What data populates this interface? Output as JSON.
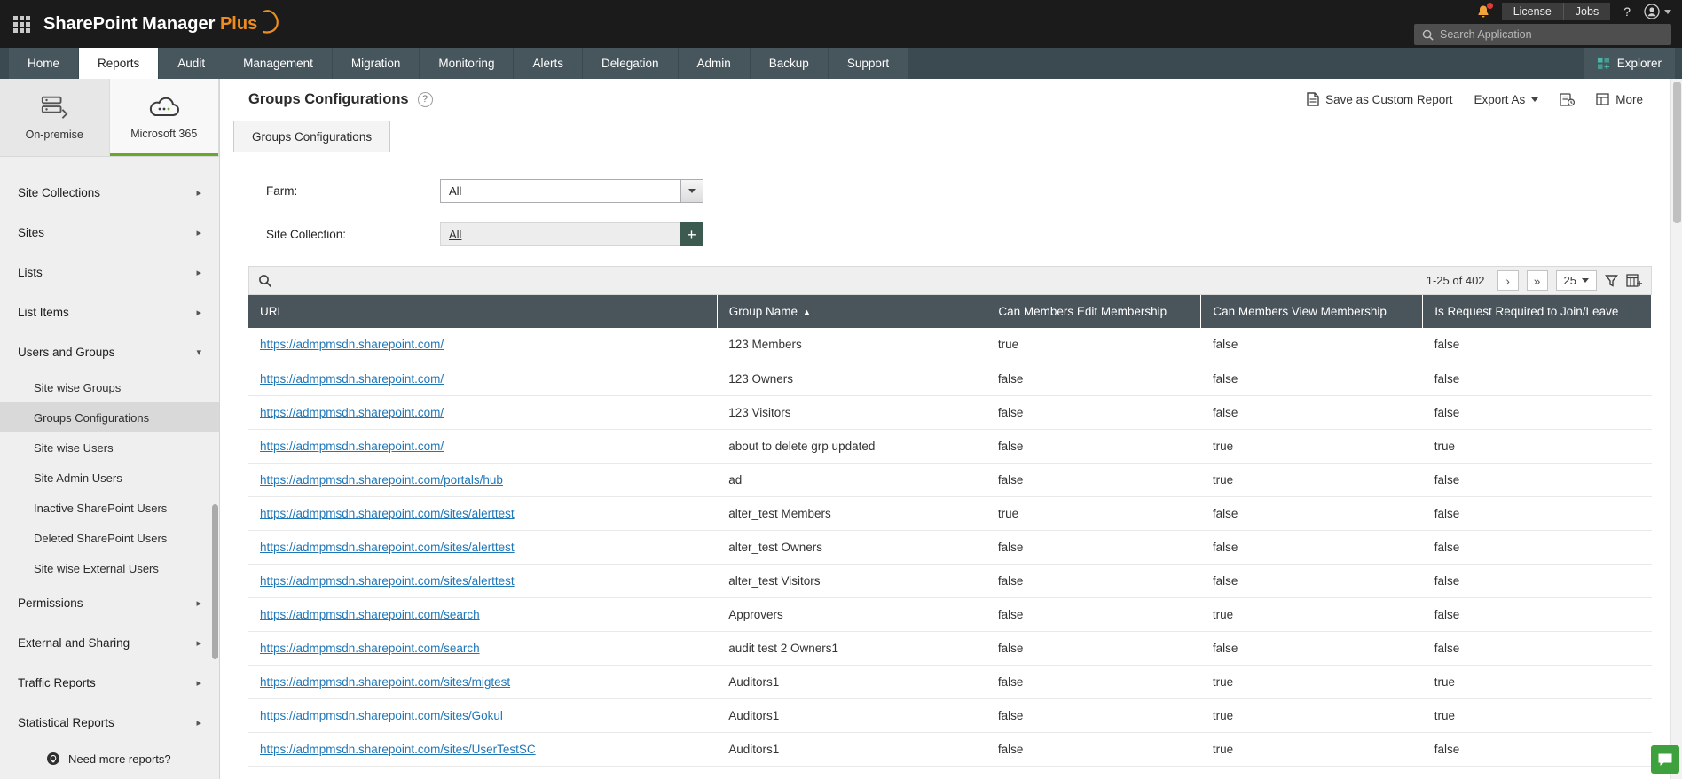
{
  "topbar": {
    "logo_main": "SharePoint Manager",
    "logo_accent": "Plus",
    "license_label": "License",
    "jobs_label": "Jobs",
    "help_glyph": "?",
    "search_placeholder": "Search Application"
  },
  "navbar": {
    "tabs": [
      "Home",
      "Reports",
      "Audit",
      "Management",
      "Migration",
      "Monitoring",
      "Alerts",
      "Delegation",
      "Admin",
      "Backup",
      "Support"
    ],
    "active_tab": "Reports",
    "explorer_label": "Explorer"
  },
  "sidebar": {
    "sources": [
      {
        "label": "On-premise",
        "active": false
      },
      {
        "label": "Microsoft 365",
        "active": true
      }
    ],
    "items": [
      {
        "label": "Site Collections"
      },
      {
        "label": "Sites"
      },
      {
        "label": "Lists"
      },
      {
        "label": "List Items"
      },
      {
        "label": "Users and Groups",
        "expanded": true,
        "children": [
          "Site wise Groups",
          "Groups Configurations",
          "Site wise Users",
          "Site Admin Users",
          "Inactive SharePoint Users",
          "Deleted SharePoint Users",
          "Site wise External Users"
        ]
      },
      {
        "label": "Permissions"
      },
      {
        "label": "External and Sharing"
      },
      {
        "label": "Traffic Reports"
      },
      {
        "label": "Statistical Reports"
      }
    ],
    "selected_item": "Groups Configurations",
    "footer_label": "Need more reports?"
  },
  "page": {
    "title": "Groups Configurations",
    "help_glyph": "?",
    "actions": {
      "save": "Save as Custom Report",
      "export": "Export As",
      "more": "More"
    },
    "tab_label": "Groups Configurations",
    "filters": {
      "farm_label": "Farm:",
      "farm_value": "All",
      "site_collection_label": "Site Collection:",
      "site_collection_value": "All",
      "add_glyph": "+"
    }
  },
  "table": {
    "pagination": {
      "range": "1-25 of 402",
      "page_size": "25"
    },
    "columns": [
      "URL",
      "Group Name",
      "Can Members Edit Membership",
      "Can Members View Membership",
      "Is Request Required to Join/Leave"
    ],
    "sort_column": "Group Name",
    "rows": [
      [
        "https://admpmsdn.sharepoint.com/",
        "123 Members",
        "true",
        "false",
        "false"
      ],
      [
        "https://admpmsdn.sharepoint.com/",
        "123 Owners",
        "false",
        "false",
        "false"
      ],
      [
        "https://admpmsdn.sharepoint.com/",
        "123 Visitors",
        "false",
        "false",
        "false"
      ],
      [
        "https://admpmsdn.sharepoint.com/",
        "about to delete grp updated",
        "false",
        "true",
        "true"
      ],
      [
        "https://admpmsdn.sharepoint.com/portals/hub",
        "ad",
        "false",
        "true",
        "false"
      ],
      [
        "https://admpmsdn.sharepoint.com/sites/alerttest",
        "alter_test Members",
        "true",
        "false",
        "false"
      ],
      [
        "https://admpmsdn.sharepoint.com/sites/alerttest",
        "alter_test Owners",
        "false",
        "false",
        "false"
      ],
      [
        "https://admpmsdn.sharepoint.com/sites/alerttest",
        "alter_test Visitors",
        "false",
        "false",
        "false"
      ],
      [
        "https://admpmsdn.sharepoint.com/search",
        "Approvers",
        "false",
        "true",
        "false"
      ],
      [
        "https://admpmsdn.sharepoint.com/search",
        "audit test 2 Owners1",
        "false",
        "false",
        "false"
      ],
      [
        "https://admpmsdn.sharepoint.com/sites/migtest",
        "Auditors1",
        "false",
        "true",
        "true"
      ],
      [
        "https://admpmsdn.sharepoint.com/sites/Gokul",
        "Auditors1",
        "false",
        "true",
        "true"
      ],
      [
        "https://admpmsdn.sharepoint.com/sites/UserTestSC",
        "Auditors1",
        "false",
        "true",
        "false"
      ]
    ]
  },
  "icons": {
    "collapsed_arrow": "▸",
    "expanded_arrow": "▾",
    "sort_asc": "▲",
    "next_page": "›",
    "last_page": "»"
  },
  "colors": {
    "accent_green": "#6aa62a",
    "header_slate": "#4a545b",
    "link_blue": "#1f77b8",
    "logo_orange": "#ef8c1f",
    "chat_green": "#3ea13e"
  }
}
